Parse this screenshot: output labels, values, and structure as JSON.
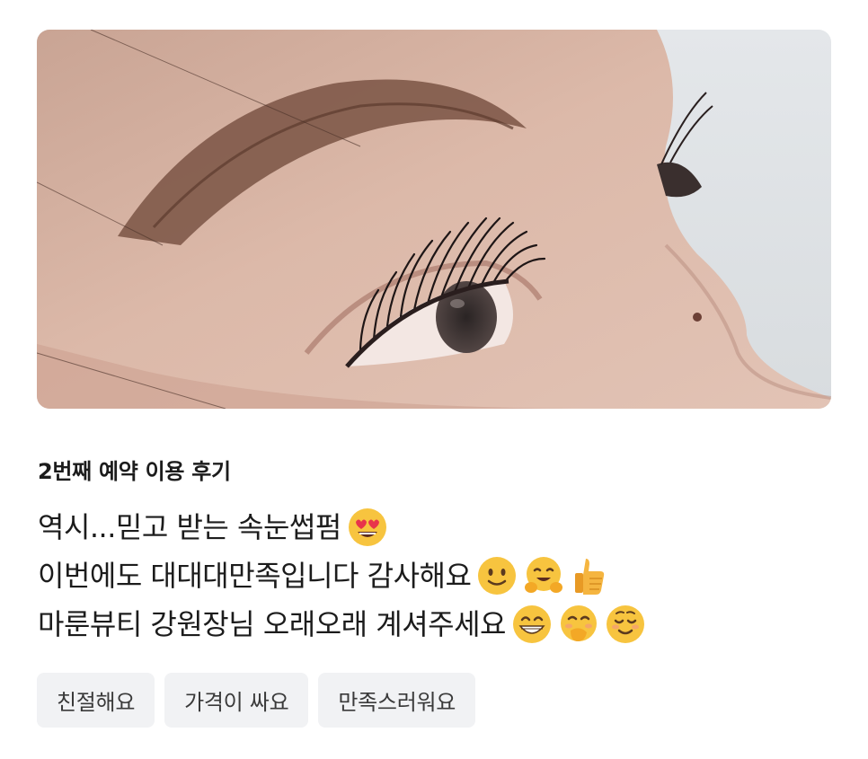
{
  "review": {
    "title": "2번째 예약 이용 후기",
    "lines": [
      {
        "text": "역시...믿고 받는 속눈썹펌",
        "emojis": [
          "heart-eyes-emoji"
        ]
      },
      {
        "text": "이번에도 대대대만족입니다 감사해요",
        "emojis": [
          "slight-smile-emoji",
          "hugging-emoji",
          "thumbs-up-emoji"
        ]
      },
      {
        "text": "마룬뷰티 강원장님 오래오래 계셔주세요",
        "emojis": [
          "grin-emoji",
          "hand-over-mouth-emoji",
          "smiling-blush-emoji"
        ]
      }
    ],
    "tags": [
      "친절해요",
      "가격이 싸요",
      "만족스러워요"
    ]
  },
  "colors": {
    "tag_background": "#f1f2f4",
    "text": "#1c1c1c",
    "skin": "#d9b2a0"
  }
}
